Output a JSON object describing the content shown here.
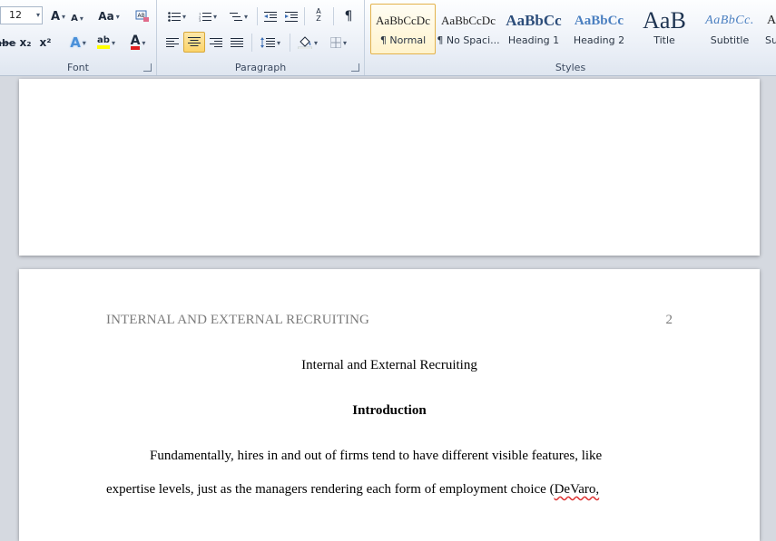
{
  "ribbon": {
    "font": {
      "label": "Font",
      "size": "12",
      "grow_label": "A",
      "shrink_label": "A",
      "case_label": "Aa",
      "strike_label": "abe",
      "sub_label": "x₂",
      "sup_label": "x²",
      "effects_label": "A",
      "highlight_label": "ab",
      "fontcolor_label": "A",
      "colors": {
        "highlight": "#ffff00",
        "font_color": "#e02020",
        "effects": "#4a90d9"
      }
    },
    "paragraph": {
      "label": "Paragraph",
      "sort_label": "A Z",
      "pilcrow": "¶"
    },
    "styles": {
      "label": "Styles",
      "items": [
        {
          "sample": "AaBbCcDc",
          "name": "¶ Normal",
          "selected": true
        },
        {
          "sample": "AaBbCcDc",
          "name": "¶ No Spaci..."
        },
        {
          "sample": "AaBbCc",
          "name": "Heading 1"
        },
        {
          "sample": "AaBbCc",
          "name": "Heading 2"
        },
        {
          "sample": "AaB",
          "name": "Title"
        },
        {
          "sample": "AaBbCc.",
          "name": "Subtitle"
        },
        {
          "sample": "A",
          "name": "Su"
        }
      ]
    },
    "accent_active": "#fbd46a"
  },
  "document": {
    "header": "INTERNAL AND EXTERNAL RECRUITING",
    "page_number": "2",
    "title": "Internal and External Recruiting",
    "heading": "Introduction",
    "line1": "Fundamentally, hires in and out of firms tend to have different visible features, like",
    "line2_pre": "expertise levels, just as the managers rendering each form of employment choice (",
    "line2_flag": "DeVaro,"
  }
}
